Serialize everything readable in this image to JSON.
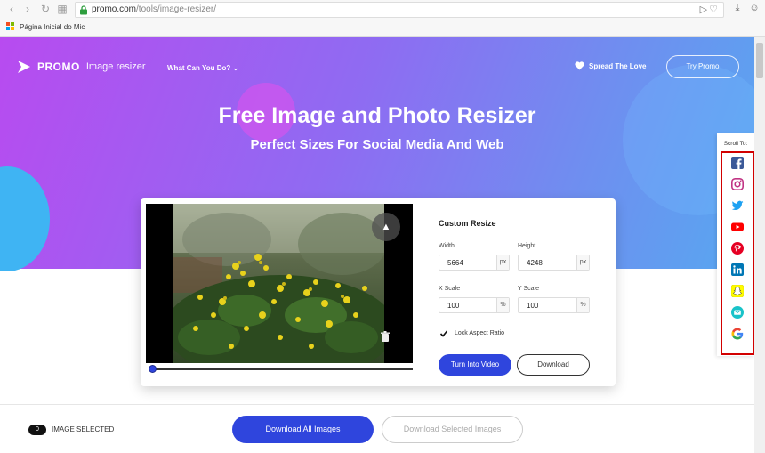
{
  "browser": {
    "url_host": "promo.com",
    "url_path": "/tools/image-resizer/",
    "bookmark_label": "Página Inicial do Mic"
  },
  "header": {
    "logo_text": "PROMO",
    "logo_sub": "Image resizer",
    "nav_link": "What Can You Do?",
    "spread_label": "Spread The Love",
    "try_label": "Try Promo"
  },
  "hero": {
    "title": "Free Image and Photo Resizer",
    "subtitle": "Perfect Sizes For Social Media And Web"
  },
  "editor": {
    "form_title": "Custom Resize",
    "width_label": "Width",
    "width_value": "5664",
    "width_unit": "px",
    "height_label": "Height",
    "height_value": "4248",
    "height_unit": "px",
    "xscale_label": "X Scale",
    "xscale_value": "100",
    "xscale_unit": "%",
    "yscale_label": "Y Scale",
    "yscale_value": "100",
    "yscale_unit": "%",
    "lock_label": "Lock Aspect Ratio",
    "lock_checked": true,
    "video_button": "Turn Into Video",
    "download_button": "Download",
    "slider_value": 0
  },
  "scroll_to": {
    "label": "Scroll To:",
    "icons": [
      "facebook-icon",
      "instagram-icon",
      "twitter-icon",
      "youtube-icon",
      "pinterest-icon",
      "linkedin-icon",
      "snapchat-icon",
      "email-icon",
      "google-icon"
    ]
  },
  "bottom": {
    "count": "0",
    "count_label": "IMAGE SELECTED",
    "download_all": "Download All Images",
    "download_selected": "Download Selected Images"
  },
  "colors": {
    "accent": "#2f45dd",
    "highlight_box": "#d20000"
  }
}
